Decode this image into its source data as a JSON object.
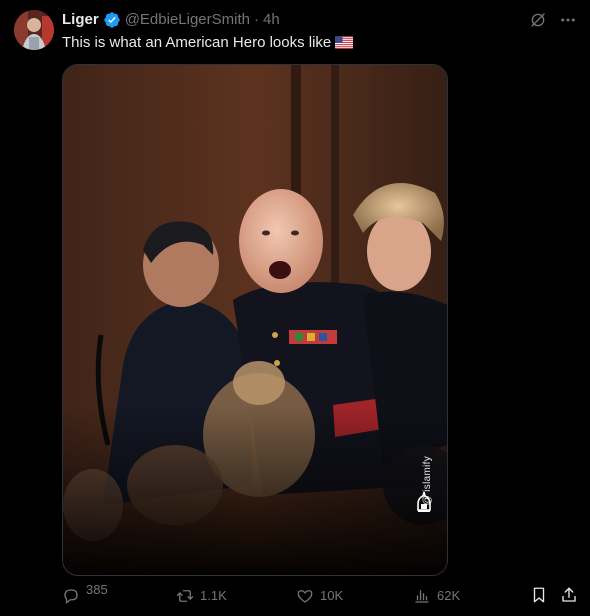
{
  "author": {
    "display_name": "Liger",
    "handle": "@EdbieLigerSmith",
    "separator": "·",
    "time": "4h",
    "verified": true
  },
  "tweet": {
    "text": "This is what an American Hero looks like",
    "emoji": "us-flag-emoji"
  },
  "media": {
    "watermark": "@ islamify",
    "icons": [
      "watermark-logo-icon"
    ]
  },
  "actions": {
    "replies": "385",
    "reposts": "1.1K",
    "likes": "10K",
    "views": "62K"
  },
  "icons": {
    "grok": "grok-icon",
    "more": "more-icon",
    "reply": "reply-icon",
    "retweet": "retweet-icon",
    "like": "heart-icon",
    "views": "views-icon",
    "bookmark": "bookmark-icon",
    "share": "share-icon"
  },
  "colors": {
    "background": "#000000",
    "text": "#e7e9ea",
    "muted": "#71767b",
    "verified": "#1d9bf0",
    "border": "#2f3336"
  }
}
